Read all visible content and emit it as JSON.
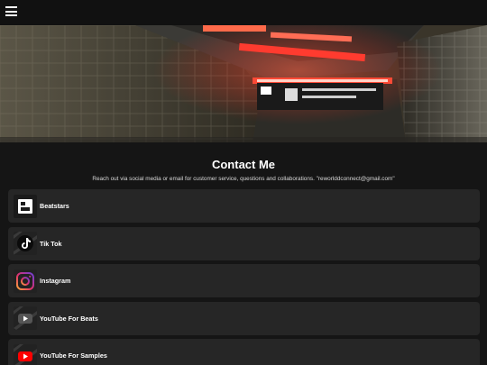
{
  "header": {
    "menu_icon": "hamburger-menu-icon"
  },
  "hero": {
    "sign_text_line1": "Brighton Beach and Coney Island",
    "sign_text_line2": "Southbound Buses",
    "sign_exit": "EXIT",
    "sign_small": "Buses"
  },
  "contact": {
    "title": "Contact Me",
    "subtitle": "Reach out via social media or email for customer service, questions and collaborations. \"reworlddconnect@gmail.com\""
  },
  "links": [
    {
      "label": "Beatstars",
      "icon": "beatstars-icon"
    },
    {
      "label": "Tik Tok",
      "icon": "tiktok-icon"
    },
    {
      "label": "Instagram",
      "icon": "instagram-icon"
    },
    {
      "label": "YouTube For Beats",
      "icon": "youtube-icon"
    },
    {
      "label": "YouTube For Samples",
      "icon": "youtube-icon"
    }
  ],
  "colors": {
    "background": "#151515",
    "card": "#262626",
    "youtube_red": "#ff0000",
    "neon_red": "#ff3b2f"
  }
}
